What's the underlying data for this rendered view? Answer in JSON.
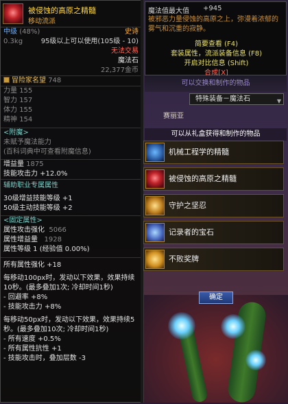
{
  "item": {
    "name": "被侵蚀的高原之精髓",
    "subtitle": "移动流派",
    "grade": "中级",
    "grade_pct": "(48%)",
    "rarity": "史诗",
    "weight": "0.3kg",
    "level_req": "95级以上可以使用(105级 - 10)",
    "trade": "无法交易",
    "type": "魔法石",
    "price": "22,377金币",
    "fame_label": "冒险家名望",
    "fame_value": "748",
    "stats": [
      {
        "name": "力量",
        "value": "155"
      },
      {
        "name": "智力",
        "value": "157"
      },
      {
        "name": "体力",
        "value": "155"
      },
      {
        "name": "精神",
        "value": "154"
      }
    ],
    "enchant_head": "<附魔>",
    "enchant_none": "未赋予魔法能力",
    "enchant_hint": "(百科词典中可查看附魔信息)",
    "boost_label": "增益量",
    "boost_value": "1875",
    "skill_atk": "技能攻击力 +12.0%",
    "assist_head": "辅助职业专属属性",
    "assist_1": "30级增益技能等级 +1",
    "assist_2": "50级主动技能等级 +2",
    "fixed_head": "<固定属性>",
    "fixed_1_label": "属性攻击强化",
    "fixed_1_value": "5066",
    "fixed_2_label": "属性增益量",
    "fixed_2_value": "1928",
    "fixed_3": "属性等级 1 (经验值 0.00%)",
    "all_elem": "所有属性强化 +18",
    "effect1": "每移动100px时，发动以下效果，效果持续10秒。(最多叠加1次; 冷却时间1秒)",
    "effect1_a": "- 回避率 +8%",
    "effect1_b": "- 技能攻击力 +8%",
    "effect2": "每移动50px时，发动以下效果，效果持续5秒。(最多叠加10次; 冷却时间1秒)",
    "effect2_a": "- 所有速度 +0.5%",
    "effect2_b": "- 所有属性抗性 +1",
    "effect2_c": "- 技能攻击时，叠加层数 -3"
  },
  "info": {
    "title": "魔法值最大值",
    "value": "+945",
    "desc": "被邪恶力量侵蚀的高原之上，弥漫着浓郁的雾气和沉重的寂静。",
    "opt1": "简要查看 (F4)",
    "opt2": "套装属性，流派装备信息 (F8)",
    "opt3": "开启对比信息 (Shift)",
    "opt4": "合成[X]"
  },
  "under_bar": "可以交换和制作的物品",
  "dropdown": {
    "selected": "特殊装备－魔法石"
  },
  "tag_bubble": "赛丽亚",
  "list": {
    "header": "可以从礼盒获得和制作的物品",
    "items": [
      {
        "label": "机械工程学的精髓",
        "icon": "gear-gem-icon"
      },
      {
        "label": "被侵蚀的高原之精髓",
        "icon": "red-gem-icon"
      },
      {
        "label": "守护之坚忍",
        "icon": "shield-icon"
      },
      {
        "label": "记录者的宝石",
        "icon": "gem-icon"
      },
      {
        "label": "不败奖牌",
        "icon": "medal-icon"
      }
    ]
  },
  "confirm_label": "确定"
}
